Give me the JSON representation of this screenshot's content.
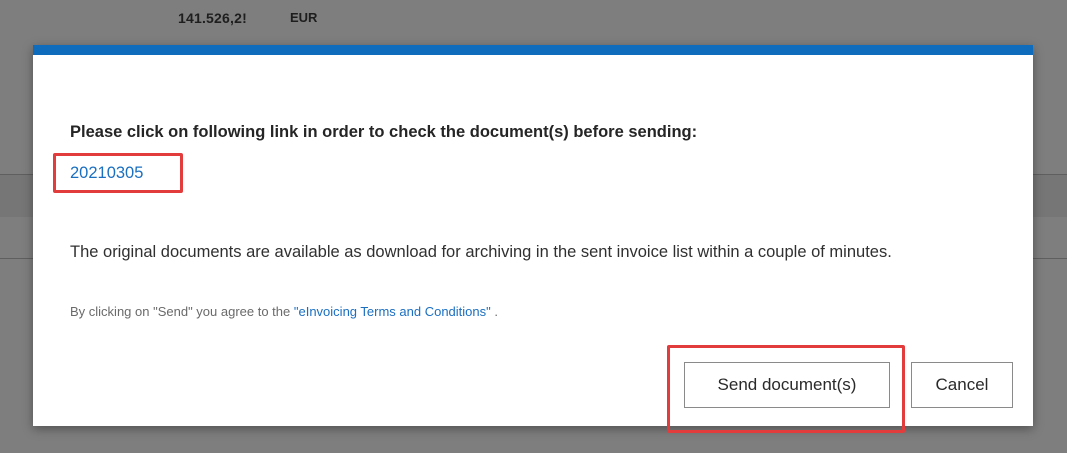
{
  "background": {
    "amount": "141.526,2!",
    "currency": "EUR"
  },
  "modal": {
    "heading": "Please click on following link in order to check the document(s) before sending:",
    "document_link": "20210305",
    "info": "The original documents are available as download for archiving in the sent invoice list within a couple of minutes.",
    "agree_prefix": "By clicking on \"Send\" you agree to the ",
    "terms_link": "\"eInvoicing Terms and Conditions\"",
    "agree_suffix": " .",
    "buttons": {
      "send": "Send document(s)",
      "cancel": "Cancel"
    }
  },
  "colors": {
    "accent": "#0f6cbd",
    "link": "#1a6fc1",
    "highlight": "#e23c3c"
  }
}
